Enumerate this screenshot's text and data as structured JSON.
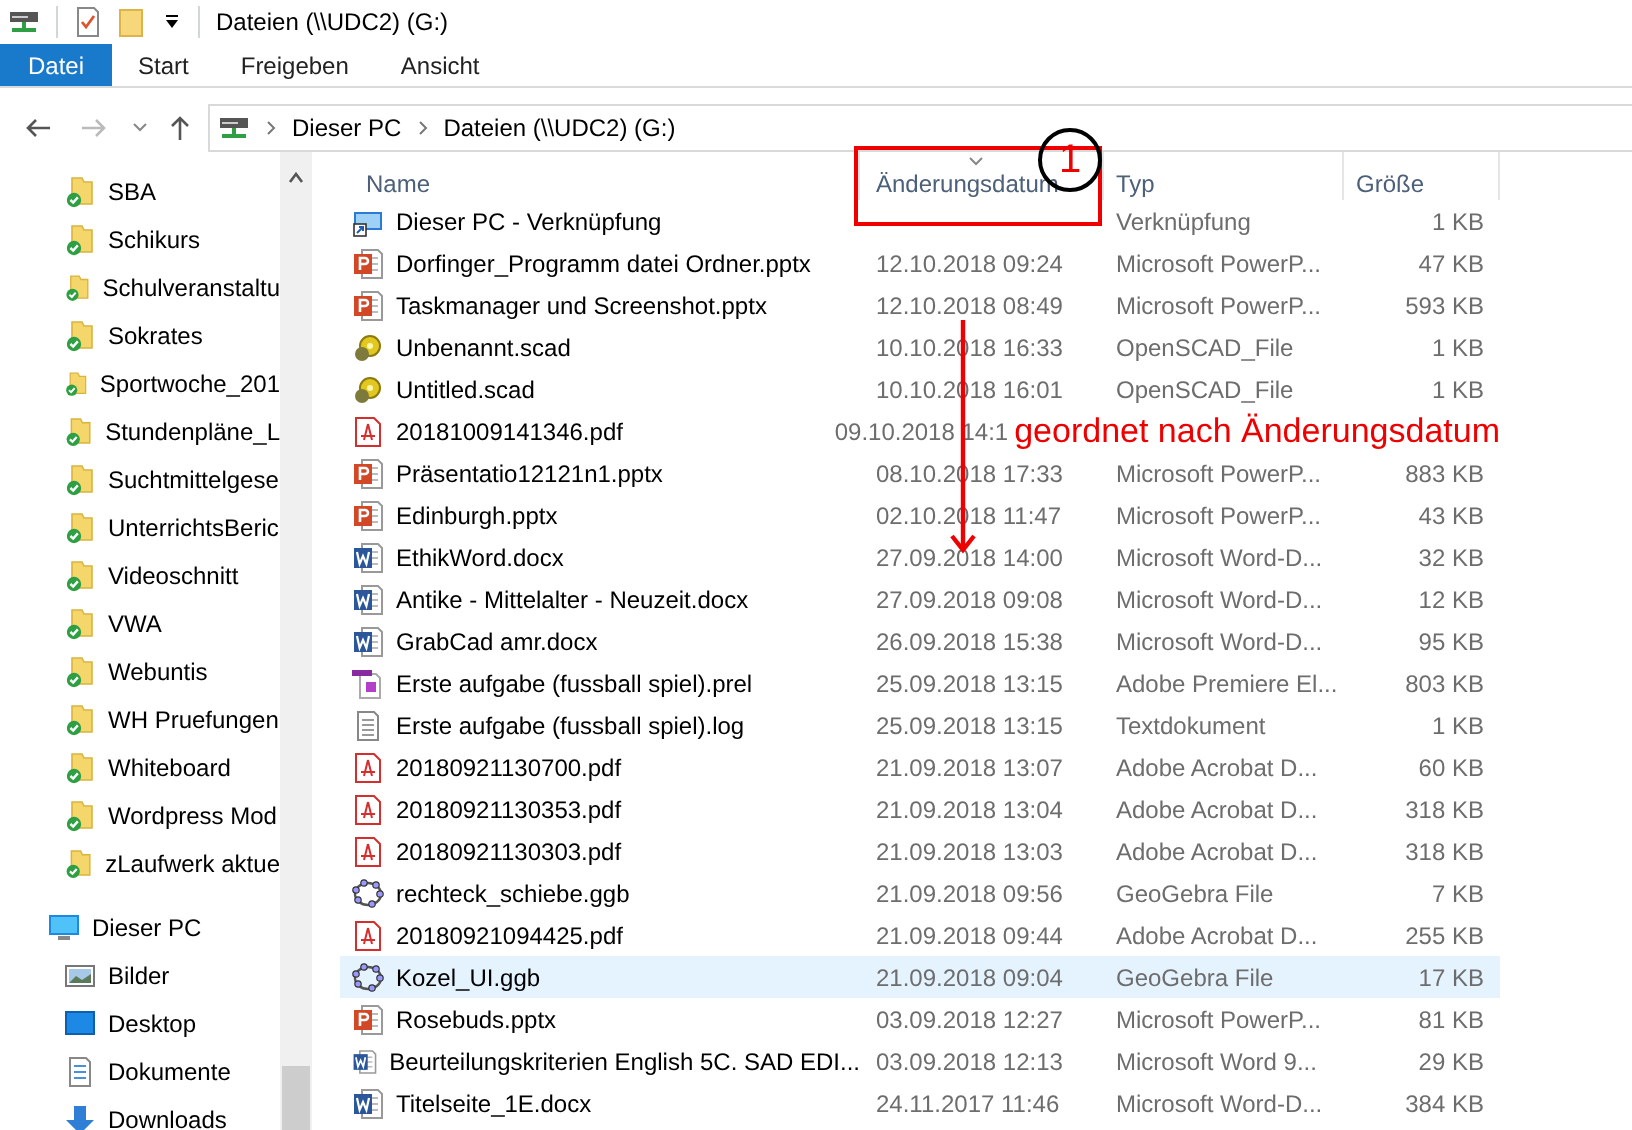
{
  "window": {
    "title": "Dateien (\\\\UDC2) (G:)"
  },
  "ribbon_tabs": [
    {
      "label": "Datei",
      "selected": true
    },
    {
      "label": "Start",
      "selected": false
    },
    {
      "label": "Freigeben",
      "selected": false
    },
    {
      "label": "Ansicht",
      "selected": false
    }
  ],
  "address_bar": {
    "path": [
      "Dieser PC",
      "Dateien (\\\\UDC2) (G:)"
    ]
  },
  "sidebar": {
    "folders": [
      "SBA",
      "Schikurs",
      "Schulveranstaltu",
      "Sokrates",
      "Sportwoche_201",
      "Stundenpläne_L",
      "Suchtmittelgese",
      "UnterrichtsBeric",
      "Videoschnitt",
      "VWA",
      "Webuntis",
      "WH Pruefungen",
      "Whiteboard",
      "Wordpress Mod",
      "zLaufwerk aktue"
    ],
    "this_pc": {
      "label": "Dieser PC",
      "items": [
        {
          "label": "Bilder",
          "kind": "pictures"
        },
        {
          "label": "Desktop",
          "kind": "desktop"
        },
        {
          "label": "Dokumente",
          "kind": "documents"
        },
        {
          "label": "Downloads",
          "kind": "downloads"
        }
      ]
    }
  },
  "table": {
    "columns": [
      {
        "label": "Name",
        "sorted": false
      },
      {
        "label": "Änderungsdatum",
        "sorted": true
      },
      {
        "label": "Typ",
        "sorted": false
      },
      {
        "label": "Größe",
        "sorted": false
      }
    ],
    "rows": [
      {
        "kind": "shortcut",
        "name": "Dieser PC - Verknüpfung",
        "type": "Verknüpfung",
        "size": "1 KB",
        "selected": false
      },
      {
        "kind": "pptx",
        "name": "Dorfinger_Programm datei Ordner.pptx",
        "date": "12.10.2018 09:24",
        "type": "Microsoft PowerP...",
        "size": "47 KB",
        "selected": false
      },
      {
        "kind": "pptx",
        "name": "Taskmanager und Screenshot.pptx",
        "date": "12.10.2018 08:49",
        "type": "Microsoft PowerP...",
        "size": "593 KB",
        "selected": false
      },
      {
        "kind": "scad",
        "name": "Unbenannt.scad",
        "date": "10.10.2018 16:33",
        "type": "OpenSCAD_File",
        "size": "1 KB",
        "selected": false
      },
      {
        "kind": "scad",
        "name": "Untitled.scad",
        "date": "10.10.2018 16:01",
        "type": "OpenSCAD_File",
        "size": "1 KB",
        "selected": false
      },
      {
        "kind": "pdf",
        "name": "20181009141346.pdf",
        "date": "09.10.2018 14:1",
        "note": "geordnet nach Änderungsdatum",
        "selected": false
      },
      {
        "kind": "pptx",
        "name": "Präsentatio12121n1.pptx",
        "date": "08.10.2018 17:33",
        "type": "Microsoft PowerP...",
        "size": "883 KB",
        "selected": false
      },
      {
        "kind": "pptx",
        "name": "Edinburgh.pptx",
        "date": "02.10.2018 11:47",
        "type": "Microsoft PowerP...",
        "size": "43 KB",
        "selected": false
      },
      {
        "kind": "docx",
        "name": "EthikWord.docx",
        "date": "27.09.2018 14:00",
        "type": "Microsoft Word-D...",
        "size": "32 KB",
        "selected": false
      },
      {
        "kind": "docx",
        "name": "Antike - Mittelalter - Neuzeit.docx",
        "date": "27.09.2018 09:08",
        "type": "Microsoft Word-D...",
        "size": "12 KB",
        "selected": false
      },
      {
        "kind": "docx",
        "name": "GrabCad amr.docx",
        "date": "26.09.2018 15:38",
        "type": "Microsoft Word-D...",
        "size": "95 KB",
        "selected": false
      },
      {
        "kind": "prel",
        "name": "Erste aufgabe (fussball spiel).prel",
        "date": "25.09.2018 13:15",
        "type": "Adobe Premiere El...",
        "size": "803 KB",
        "selected": false
      },
      {
        "kind": "log",
        "name": "Erste aufgabe (fussball spiel).log",
        "date": "25.09.2018 13:15",
        "type": "Textdokument",
        "size": "1 KB",
        "selected": false
      },
      {
        "kind": "pdf",
        "name": "20180921130700.pdf",
        "date": "21.09.2018 13:07",
        "type": "Adobe Acrobat D...",
        "size": "60 KB",
        "selected": false
      },
      {
        "kind": "pdf",
        "name": "20180921130353.pdf",
        "date": "21.09.2018 13:04",
        "type": "Adobe Acrobat D...",
        "size": "318 KB",
        "selected": false
      },
      {
        "kind": "pdf",
        "name": "20180921130303.pdf",
        "date": "21.09.2018 13:03",
        "type": "Adobe Acrobat D...",
        "size": "318 KB",
        "selected": false
      },
      {
        "kind": "ggb",
        "name": "rechteck_schiebe.ggb",
        "date": "21.09.2018 09:56",
        "type": "GeoGebra File",
        "size": "7 KB",
        "selected": false
      },
      {
        "kind": "pdf",
        "name": "20180921094425.pdf",
        "date": "21.09.2018 09:44",
        "type": "Adobe Acrobat D...",
        "size": "255 KB",
        "selected": false
      },
      {
        "kind": "ggb",
        "name": "Kozel_UI.ggb",
        "date": "21.09.2018 09:04",
        "type": "GeoGebra File",
        "size": "17 KB",
        "selected": true
      },
      {
        "kind": "pptx",
        "name": "Rosebuds.pptx",
        "date": "03.09.2018 12:27",
        "type": "Microsoft PowerP...",
        "size": "81 KB",
        "selected": false
      },
      {
        "kind": "docx",
        "name": "Beurteilungskriterien English 5C. SAD EDI...",
        "date": "03.09.2018 12:13",
        "type": "Microsoft Word 9...",
        "size": "29 KB",
        "selected": false
      },
      {
        "kind": "docx",
        "name": "Titelseite_1E.docx",
        "date": "24.11.2017 11:46",
        "type": "Microsoft Word-D...",
        "size": "384 KB",
        "selected": false
      }
    ]
  },
  "annotation": {
    "marker": "1"
  }
}
